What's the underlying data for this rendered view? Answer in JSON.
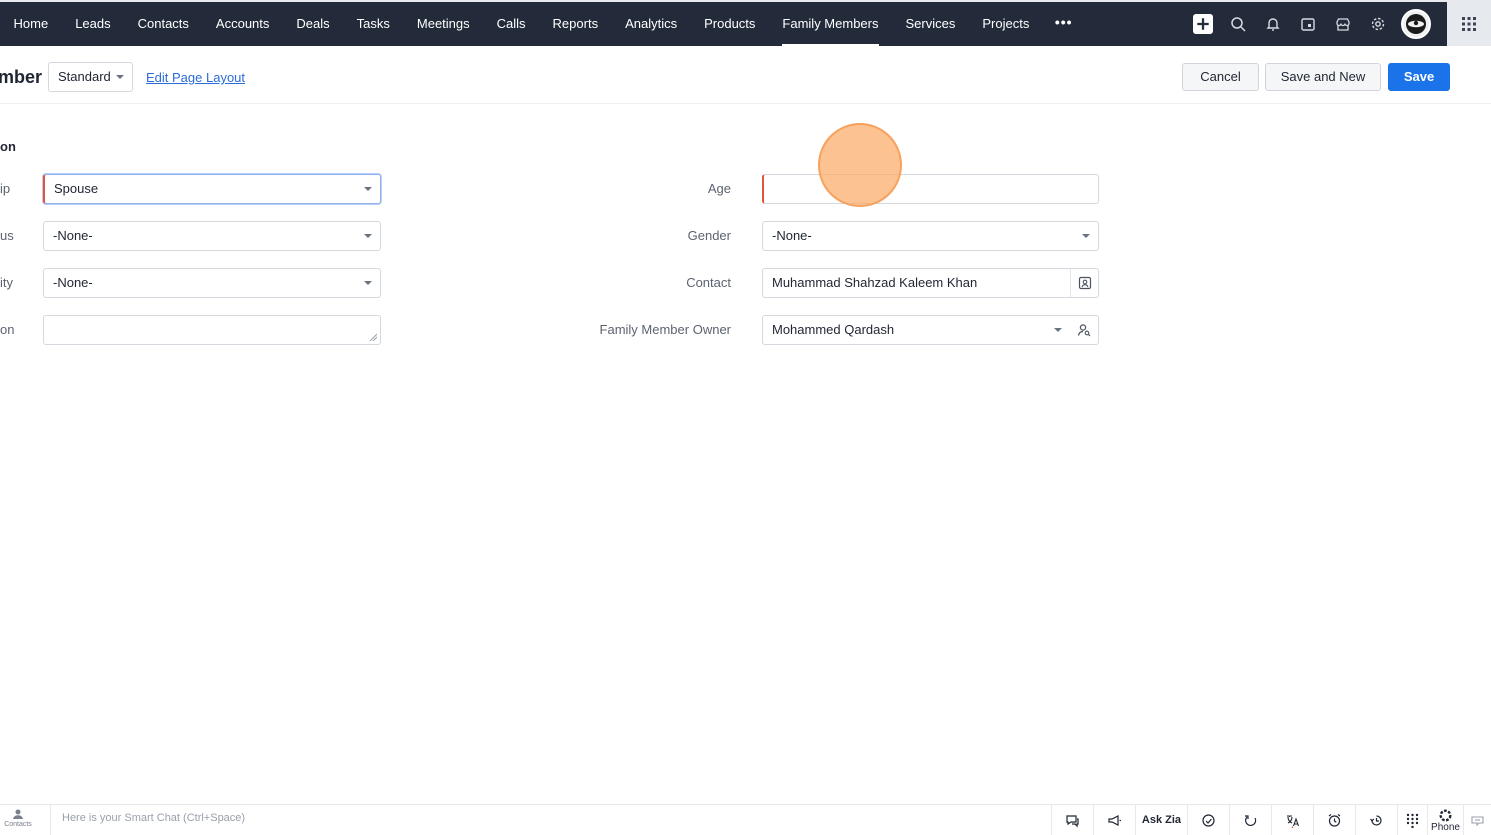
{
  "nav": {
    "tabs": [
      "Home",
      "Leads",
      "Contacts",
      "Accounts",
      "Deals",
      "Tasks",
      "Meetings",
      "Calls",
      "Reports",
      "Analytics",
      "Products",
      "Family Members",
      "Services",
      "Projects"
    ],
    "active_tab": "Family Members",
    "more_label": "•••",
    "icons": [
      "plus-icon",
      "search-icon",
      "bell-icon",
      "calendar-icon",
      "marketplace-icon",
      "gear-icon",
      "avatar",
      "apps-grid-icon"
    ]
  },
  "header": {
    "title": "mber",
    "layout_value": "Standard",
    "edit_layout_link": "Edit Page Layout",
    "cancel_label": "Cancel",
    "save_new_label": "Save and New",
    "save_label": "Save"
  },
  "form": {
    "section_title": "on",
    "left": [
      {
        "label": "ip",
        "value": "Spouse",
        "type": "select"
      },
      {
        "label": "us",
        "value": "-None-",
        "type": "select"
      },
      {
        "label": "ity",
        "value": "-None-",
        "type": "select"
      },
      {
        "label": "on",
        "value": "",
        "type": "textarea"
      }
    ],
    "right": [
      {
        "label": "Age",
        "value": "",
        "type": "text"
      },
      {
        "label": "Gender",
        "value": "-None-",
        "type": "select"
      },
      {
        "label": "Contact",
        "value": "Muhammad Shahzad Kaleem Khan",
        "type": "lookup"
      },
      {
        "label": "Family Member Owner",
        "value": "Mohammed Qardash",
        "type": "user-lookup"
      }
    ]
  },
  "bottom": {
    "contacts_label": "Contacts",
    "smartchat_placeholder": "Here is your Smart Chat (Ctrl+Space)",
    "ask_zia": "Ask Zia",
    "phone": "Phone"
  },
  "colors": {
    "nav_bg": "#232b3a",
    "primary": "#1a73e8",
    "required": "#e5533d",
    "click_marker": "#f6a15e"
  }
}
